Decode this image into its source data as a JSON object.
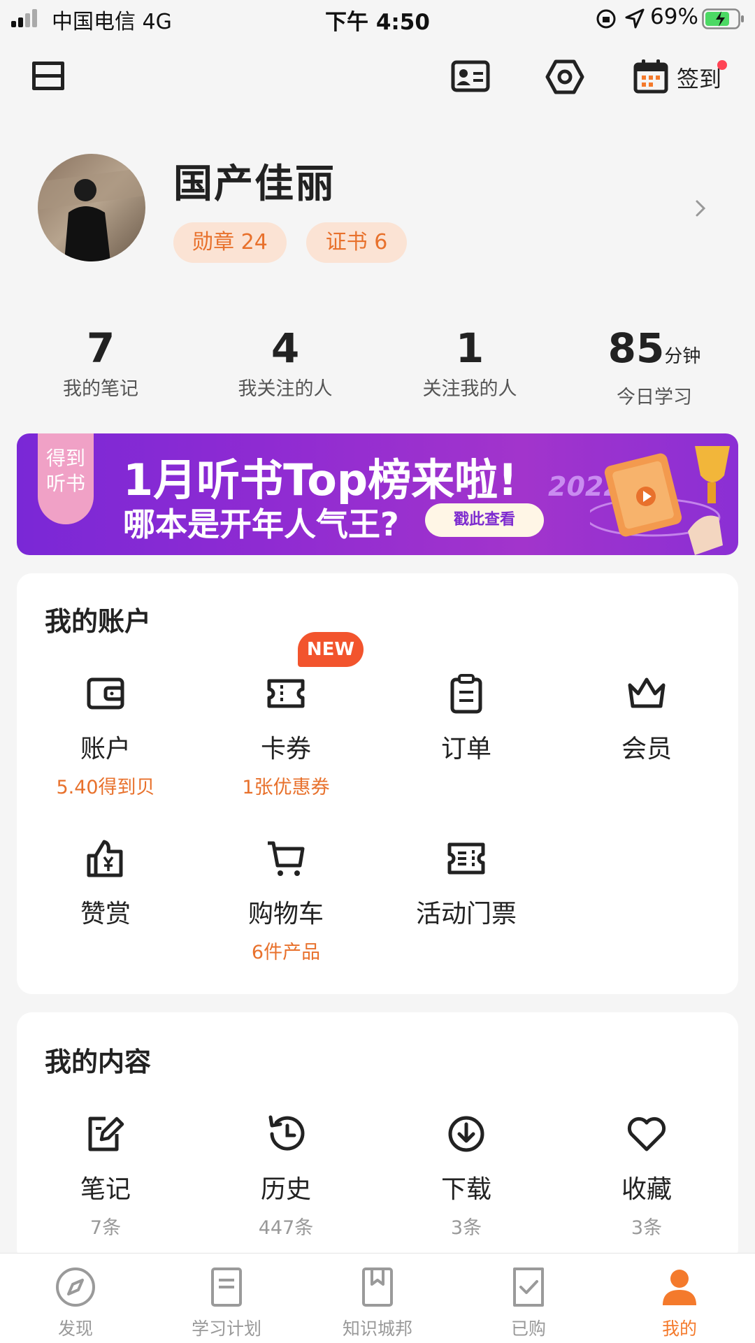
{
  "status_bar": {
    "carrier": "中国电信  4G",
    "time": "下午 4:50",
    "battery": "69%"
  },
  "header": {
    "sign_in": "签到"
  },
  "profile": {
    "name": "国产佳丽",
    "medal": "勋章 24",
    "cert": "证书 6"
  },
  "stats": [
    {
      "value": "7",
      "unit": "",
      "label": "我的笔记"
    },
    {
      "value": "4",
      "unit": "",
      "label": "我关注的人"
    },
    {
      "value": "1",
      "unit": "",
      "label": "关注我的人"
    },
    {
      "value": "85",
      "unit": "分钟",
      "label": "今日学习"
    }
  ],
  "banner": {
    "tag_line1": "得到",
    "tag_line2": "听书",
    "title": "1月听书Top榜来啦!",
    "subtitle": "哪本是开年人气王?",
    "button": "戳此查看",
    "year": "2022"
  },
  "account": {
    "title": "我的账户",
    "new_badge": "NEW",
    "items": [
      {
        "icon": "wallet-icon",
        "label": "账户",
        "sub": "5.40得到贝"
      },
      {
        "icon": "coupon-icon",
        "label": "卡券",
        "sub": "1张优惠券"
      },
      {
        "icon": "clipboard-icon",
        "label": "订单",
        "sub": ""
      },
      {
        "icon": "crown-icon",
        "label": "会员",
        "sub": ""
      },
      {
        "icon": "thumbs-up-yen-icon",
        "label": "赞赏",
        "sub": ""
      },
      {
        "icon": "cart-icon",
        "label": "购物车",
        "sub": "6件产品"
      },
      {
        "icon": "ticket-icon",
        "label": "活动门票",
        "sub": ""
      }
    ]
  },
  "content": {
    "title": "我的内容",
    "items": [
      {
        "icon": "note-edit-icon",
        "label": "笔记",
        "sub": "7条"
      },
      {
        "icon": "history-icon",
        "label": "历史",
        "sub": "447条"
      },
      {
        "icon": "download-icon",
        "label": "下载",
        "sub": "3条"
      },
      {
        "icon": "heart-icon",
        "label": "收藏",
        "sub": "3条"
      }
    ]
  },
  "tabs": [
    {
      "label": "发现",
      "icon": "compass-icon"
    },
    {
      "label": "学习计划",
      "icon": "plan-doc-icon"
    },
    {
      "label": "知识城邦",
      "icon": "bookmark-book-icon"
    },
    {
      "label": "已购",
      "icon": "purchased-check-icon"
    },
    {
      "label": "我的",
      "icon": "person-icon"
    }
  ],
  "colors": {
    "accent": "#f47a2c",
    "pill_bg": "#fbe3d4",
    "banner": "#8f2bd2",
    "new_badge": "#f2542d"
  }
}
